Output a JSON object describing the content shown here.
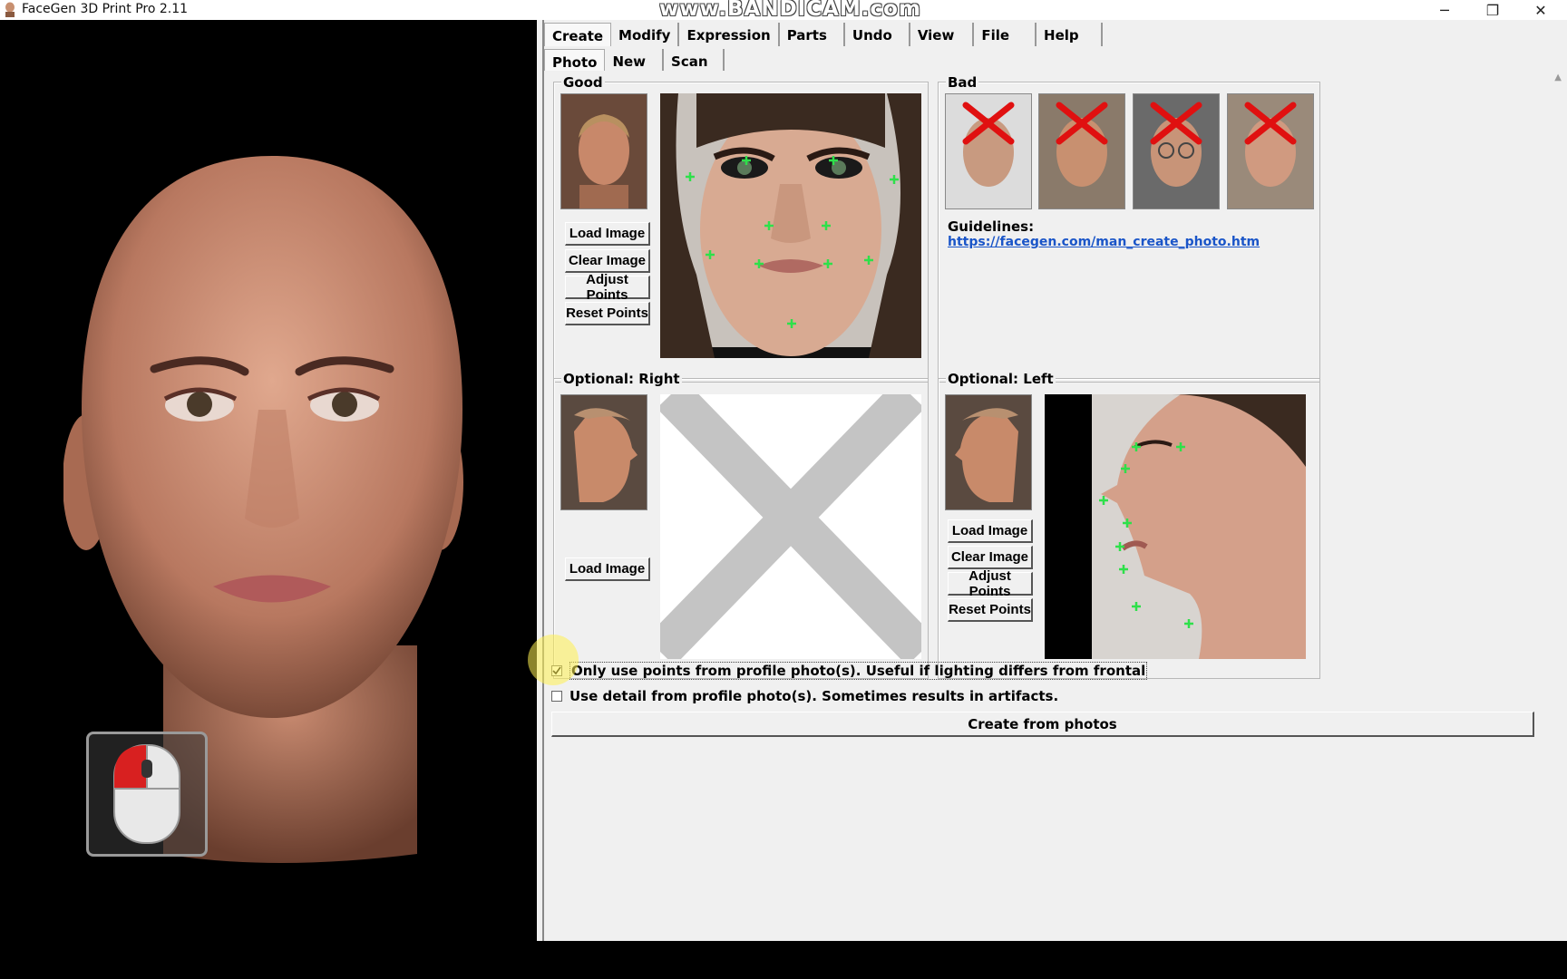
{
  "window": {
    "title": "FaceGen 3D Print Pro 2.11",
    "watermark": "www.BANDICAM.com",
    "controls": {
      "minimize": "─",
      "restore": "❐",
      "close": "✕"
    }
  },
  "menu": {
    "tabs": [
      "Create",
      "Modify",
      "Expression",
      "Parts",
      "Undo",
      "View",
      "File",
      "Help"
    ],
    "subtabs": [
      "Photo",
      "New",
      "Scan"
    ]
  },
  "good": {
    "label": "Good",
    "buttons": {
      "load": "Load Image",
      "clear": "Clear Image",
      "adjust": "Adjust Points",
      "reset": "Reset Points"
    }
  },
  "bad": {
    "label": "Bad",
    "guidelines_label": "Guidelines:",
    "guidelines_link": "https://facegen.com/man_create_photo.htm"
  },
  "optional_right": {
    "label": "Optional: Right",
    "buttons": {
      "load": "Load Image"
    }
  },
  "optional_left": {
    "label": "Optional: Left",
    "buttons": {
      "load": "Load Image",
      "clear": "Clear Image",
      "adjust": "Adjust Points",
      "reset": "Reset Points"
    }
  },
  "options": {
    "profile_points": "Only use points from profile photo(s). Useful if lighting differs from frontal",
    "profile_points_checked": true,
    "profile_detail": "Use detail from profile photo(s). Sometimes results in artifacts.",
    "profile_detail_checked": false
  },
  "create_button": "Create from photos",
  "colors": {
    "accent_green": "#2ee04a",
    "bad_x": "#e01010",
    "link": "#1a55c8"
  }
}
